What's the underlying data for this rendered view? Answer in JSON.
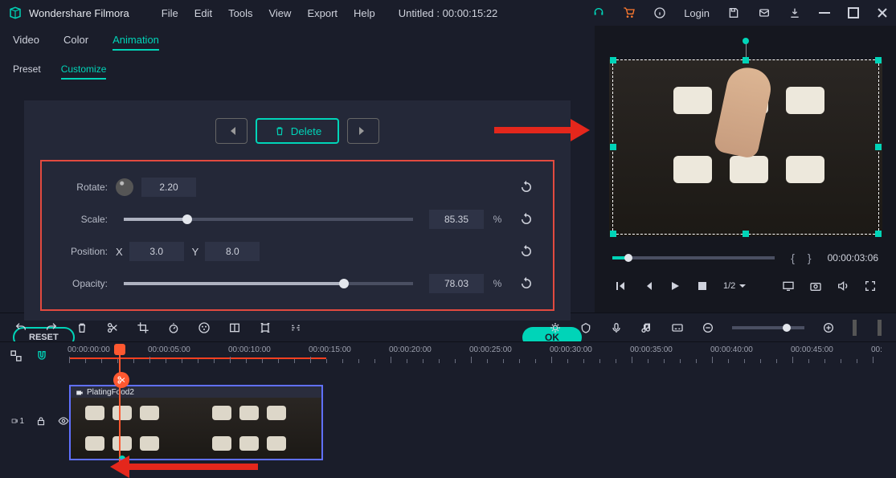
{
  "app_title": "Wondershare Filmora",
  "menu": [
    "File",
    "Edit",
    "Tools",
    "View",
    "Export",
    "Help"
  ],
  "project_title": "Untitled : 00:00:15:22",
  "login_label": "Login",
  "tabs": {
    "video": "Video",
    "color": "Color",
    "animation": "Animation"
  },
  "subtabs": {
    "preset": "Preset",
    "customize": "Customize"
  },
  "delete_label": "Delete",
  "params": {
    "rotate": {
      "label": "Rotate:",
      "value": "2.20"
    },
    "scale": {
      "label": "Scale:",
      "value": "85.35",
      "pct": "%"
    },
    "position": {
      "label": "Position:",
      "x_label": "X",
      "x": "3.0",
      "y_label": "Y",
      "y": "8.0"
    },
    "opacity": {
      "label": "Opacity:",
      "value": "78.03",
      "pct": "%"
    }
  },
  "reset_label": "RESET",
  "ok_label": "OK",
  "preview_timecode": "00:00:03:06",
  "speed": "1/2",
  "timeline": {
    "ticks": [
      "00:00:00:00",
      "00:00:05:00",
      "00:00:10:00",
      "00:00:15:00",
      "00:00:20:00",
      "00:00:25:00",
      "00:00:30:00",
      "00:00:35:00",
      "00:00:40:00",
      "00:00:45:00",
      "00:"
    ],
    "clip_label": "PlatingFood2",
    "track_badge": "1"
  }
}
